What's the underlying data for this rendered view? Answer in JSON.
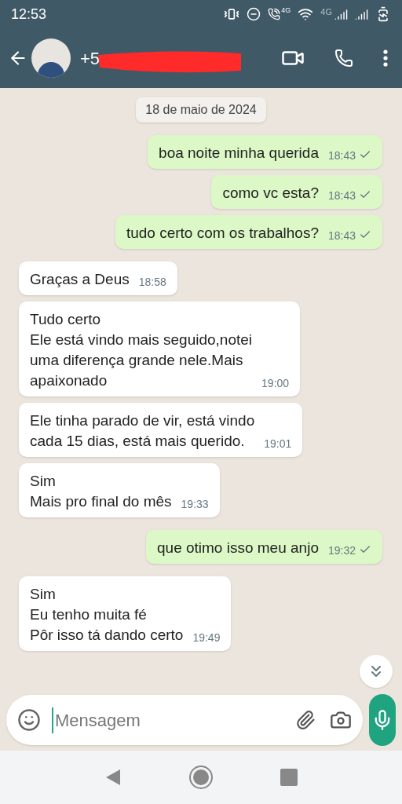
{
  "status_bar": {
    "time": "12:53",
    "network_labels": [
      "4G",
      "4G"
    ]
  },
  "header": {
    "contact": "+5",
    "redacted": true
  },
  "date_chip": "18 de maio de 2024",
  "messages": [
    {
      "kind": "outgoing",
      "lines": [
        "boa noite minha querida"
      ],
      "time": "18:43",
      "sent": true
    },
    {
      "kind": "outgoing",
      "lines": [
        "como vc esta?"
      ],
      "time": "18:43",
      "sent": true
    },
    {
      "kind": "outgoing",
      "lines": [
        "tudo certo com os trabalhos?"
      ],
      "time": "18:43",
      "sent": true
    },
    {
      "kind": "incoming",
      "lines": [
        "Graças a Deus"
      ],
      "time": "18:58"
    },
    {
      "kind": "incoming",
      "lines": [
        "Tudo certo",
        "Ele está vindo mais seguido,notei",
        "uma diferença grande nele.Mais",
        "apaixonado"
      ],
      "time": "19:00"
    },
    {
      "kind": "incoming",
      "lines": [
        "Ele tinha parado de vir, está vindo",
        "cada 15 dias, está mais querido."
      ],
      "time": "19:01"
    },
    {
      "kind": "incoming",
      "lines": [
        "Sim",
        "Mais pro final do mês"
      ],
      "time": "19:33"
    },
    {
      "kind": "outgoing",
      "lines": [
        "que otimo isso meu anjo"
      ],
      "time": "19:32",
      "sent": true
    },
    {
      "kind": "incoming",
      "lines": [
        "Sim",
        "Eu tenho muita fé",
        "Pôr isso tá dando certo"
      ],
      "time": "19:49"
    }
  ],
  "composer": {
    "placeholder": "Mensagem"
  }
}
